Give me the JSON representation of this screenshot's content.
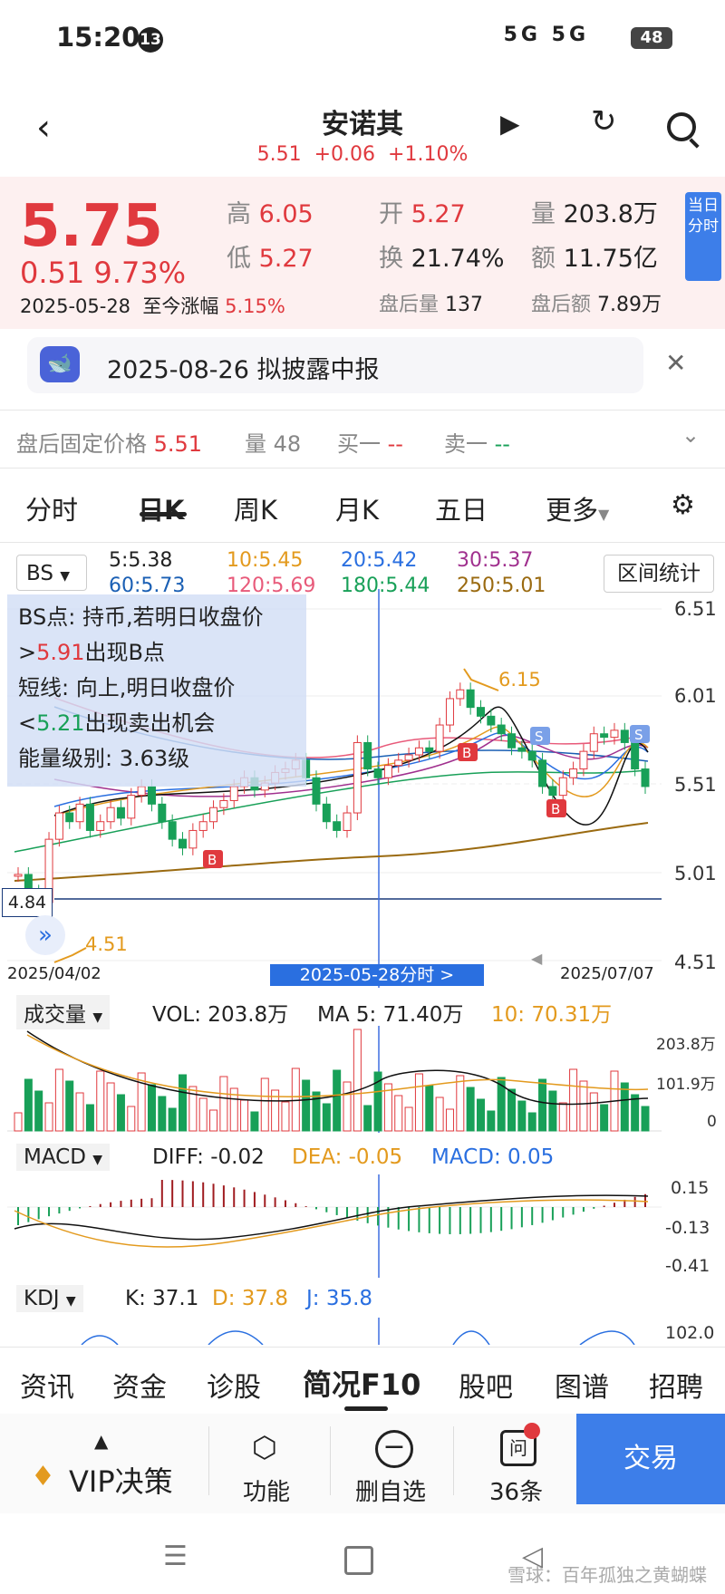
{
  "status": {
    "time": "15:20",
    "badge": "13",
    "network": "5G 5G",
    "battery": "48"
  },
  "header": {
    "title": "安诺其",
    "price": "5.51",
    "change": "+0.06",
    "pct": "+1.10%"
  },
  "quote": {
    "price": "5.75",
    "change": "0.51",
    "pct": "9.73%",
    "date": "2025-05-28",
    "since_label": "至今涨幅",
    "since_value": "5.15%",
    "high_label": "高",
    "high": "6.05",
    "low_label": "低",
    "low": "5.27",
    "open_label": "开",
    "open": "5.27",
    "turnover_label": "换",
    "turnover": "21.74%",
    "vol_label": "量",
    "vol": "203.8万",
    "amount_label": "额",
    "amount": "11.75亿",
    "after_vol_label": "盘后量",
    "after_vol": "137",
    "after_amount_label": "盘后额",
    "after_amount": "7.89万",
    "intraday_btn": "当日分时"
  },
  "notice": {
    "text": "2025-08-26 拟披露中报"
  },
  "after_hours": {
    "fixed_label": "盘后固定价格",
    "fixed": "5.51",
    "vol_label": "量",
    "vol": "48",
    "buy_label": "买一",
    "buy": "--",
    "sell_label": "卖一",
    "sell": "--"
  },
  "tabs": [
    "分时",
    "日K",
    "周K",
    "月K",
    "五日",
    "更多"
  ],
  "chart": {
    "indicator": "BS",
    "ma": [
      "5:5.38",
      "10:5.45",
      "20:5.42",
      "30:5.37",
      "60:5.73",
      "120:5.69",
      "180:5.44",
      "250:5.01"
    ],
    "range_btn": "区间统计",
    "y_ticks": [
      "6.51",
      "6.01",
      "5.51",
      "5.01",
      "4.51"
    ],
    "current_marker": "4.84",
    "low_label": "4.51",
    "high_label": "6.15",
    "start_date": "2025/04/02",
    "end_date": "2025/07/07",
    "cursor_date": "2025-05-28分时 >",
    "tooltip": {
      "line1": "BS点: 持币,若明日收盘价",
      "line2_prefix": ">",
      "line2_value": "5.91",
      "line2_suffix": "出现B点",
      "line3": "短线: 向上,明日收盘价",
      "line4_prefix": "<",
      "line4_value": "5.21",
      "line4_suffix": "出现卖出机会",
      "line5": "能量级别: 3.63级"
    }
  },
  "chart_data": {
    "type": "candlestick",
    "x_range": [
      "2025/04/02",
      "2025/07/07"
    ],
    "ylim": [
      4.51,
      6.51
    ],
    "closes": [
      5.0,
      4.9,
      4.84,
      5.2,
      5.35,
      5.3,
      5.4,
      5.25,
      5.3,
      5.38,
      5.32,
      5.45,
      5.5,
      5.4,
      5.3,
      5.2,
      5.15,
      5.25,
      5.3,
      5.38,
      5.42,
      5.5,
      5.55,
      5.48,
      5.52,
      5.58,
      5.6,
      5.65,
      5.55,
      5.4,
      5.3,
      5.25,
      5.35,
      5.75,
      5.6,
      5.55,
      5.62,
      5.65,
      5.68,
      5.72,
      5.7,
      5.85,
      6.0,
      6.05,
      5.95,
      5.9,
      5.85,
      5.8,
      5.72,
      5.7,
      5.65,
      5.5,
      5.45,
      5.55,
      5.6,
      5.7,
      5.8,
      5.78,
      5.82,
      5.75,
      5.6,
      5.5
    ]
  },
  "volume": {
    "label": "成交量",
    "vol": "VOL: 203.8万",
    "ma5": "MA 5: 71.40万",
    "ma10": "10: 70.31万",
    "ticks": [
      "203.8万",
      "101.9万",
      "0"
    ]
  },
  "macd": {
    "label": "MACD",
    "diff": "DIFF: -0.02",
    "dea": "DEA: -0.05",
    "macd": "MACD: 0.05",
    "ticks": [
      "0.15",
      "-0.13",
      "-0.41"
    ]
  },
  "kdj": {
    "label": "KDJ",
    "k": "K: 37.1",
    "d": "D: 37.8",
    "j": "J: 35.8",
    "tick": "102.0"
  },
  "bottom_tabs": [
    "资讯",
    "资金",
    "诊股",
    "简况F10",
    "股吧",
    "图谱",
    "招聘"
  ],
  "actions": {
    "vip": "VIP决策",
    "func": "功能",
    "remove": "删自选",
    "msgs": "36条",
    "trade": "交易"
  },
  "watermark": "雪球：百年孤独之黄蝴蝶"
}
